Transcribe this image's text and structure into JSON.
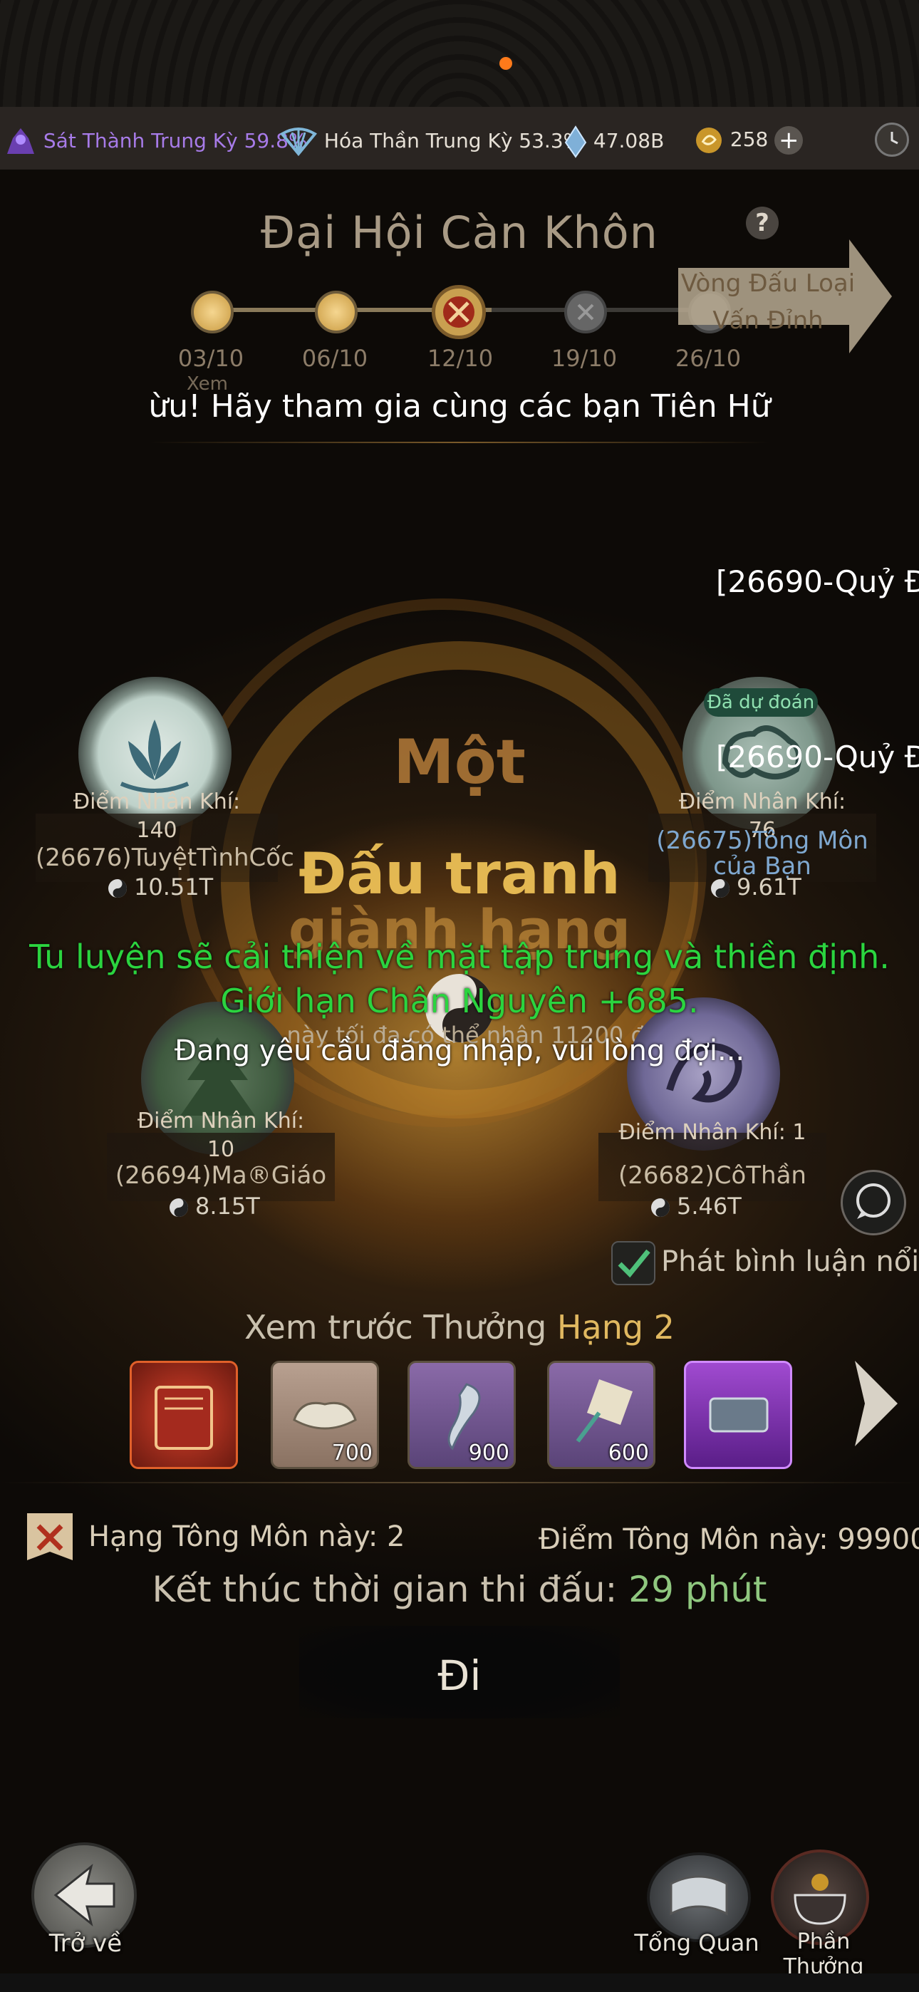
{
  "status_bar": {
    "realm1": "Sát Thành Trung Kỳ 59.8%",
    "realm2": "Hóa Thần Trung Kỳ 53.3%",
    "currency_crystal": "47.08B",
    "currency_gold": "258",
    "plus_icon": "+"
  },
  "header": {
    "title": "Đại Hội Càn Khôn",
    "help_icon": "?"
  },
  "timeline": {
    "dates": [
      "03/10",
      "06/10",
      "12/10",
      "19/10",
      "26/10"
    ],
    "next_label": "Vòng Đấu Loại Vấn Đỉnh",
    "partial_label": "Xem"
  },
  "banner_text": "ừu! Hãy tham gia cùng các bạn Tiên Hữ",
  "right_msg_1": "[26690-Quỷ Đ",
  "right_msg_2": "[26690-Quỷ Đ",
  "sects": [
    {
      "label": "Điểm Nhân Khí:",
      "points": "140",
      "name": "(26676)TuyệtTìnhCốc",
      "power": "10.51T"
    },
    {
      "label": "Điểm Nhân Khí:",
      "points": "76",
      "name": "(26675)Tông Môn của Bạn",
      "power": "9.61T",
      "badge": "Đã dự đoán"
    },
    {
      "label": "Điểm Nhân Khí:",
      "points": "10",
      "name": "(26694)Ma®Giáo",
      "power": "8.15T"
    },
    {
      "label": "Điểm Nhân Khí: 1",
      "points": "",
      "name": "(26682)CôThần",
      "power": "5.46T"
    }
  ],
  "center": {
    "line1": "Một",
    "line2": "Đấu tranh",
    "line3": "giành hạng",
    "note": "Trận này tối đa có thể nhận 11200 điểm"
  },
  "green_msg": "Tu luyện sẽ cải thiện về mặt tập trung và thiền định. Giới hạn Chân Nguyên +685.",
  "req_msg": "Đang yêu cầu đăng nhập, vui lòng đợi...",
  "comment_toggle": "Phát bình luận nổi",
  "reward": {
    "title_prefix": "Xem trước Thưởng",
    "title_rank": "Hạng 2",
    "items": [
      {
        "icon": "red-book-icon",
        "count": ""
      },
      {
        "icon": "silver-ingot-icon",
        "count": "700"
      },
      {
        "icon": "jade-hook-icon",
        "count": "900"
      },
      {
        "icon": "talisman-key-icon",
        "count": "600"
      },
      {
        "icon": "purple-card-icon",
        "count": ""
      }
    ]
  },
  "rank_text": "Hạng Tông Môn này: 2",
  "score_text": "Điểm Tông Môn này: 99900",
  "end_time": {
    "label": "Kết thúc thời gian thi đấu:",
    "value": "29 phút"
  },
  "go_button": "Đi",
  "nav": {
    "back": "Trở về",
    "overview": "Tổng Quan",
    "reward": "Phần Thưởng"
  },
  "colors": {
    "accent_green": "#2bd43f",
    "gold": "#e0b860",
    "notch_dot": "#ff7a1a"
  }
}
